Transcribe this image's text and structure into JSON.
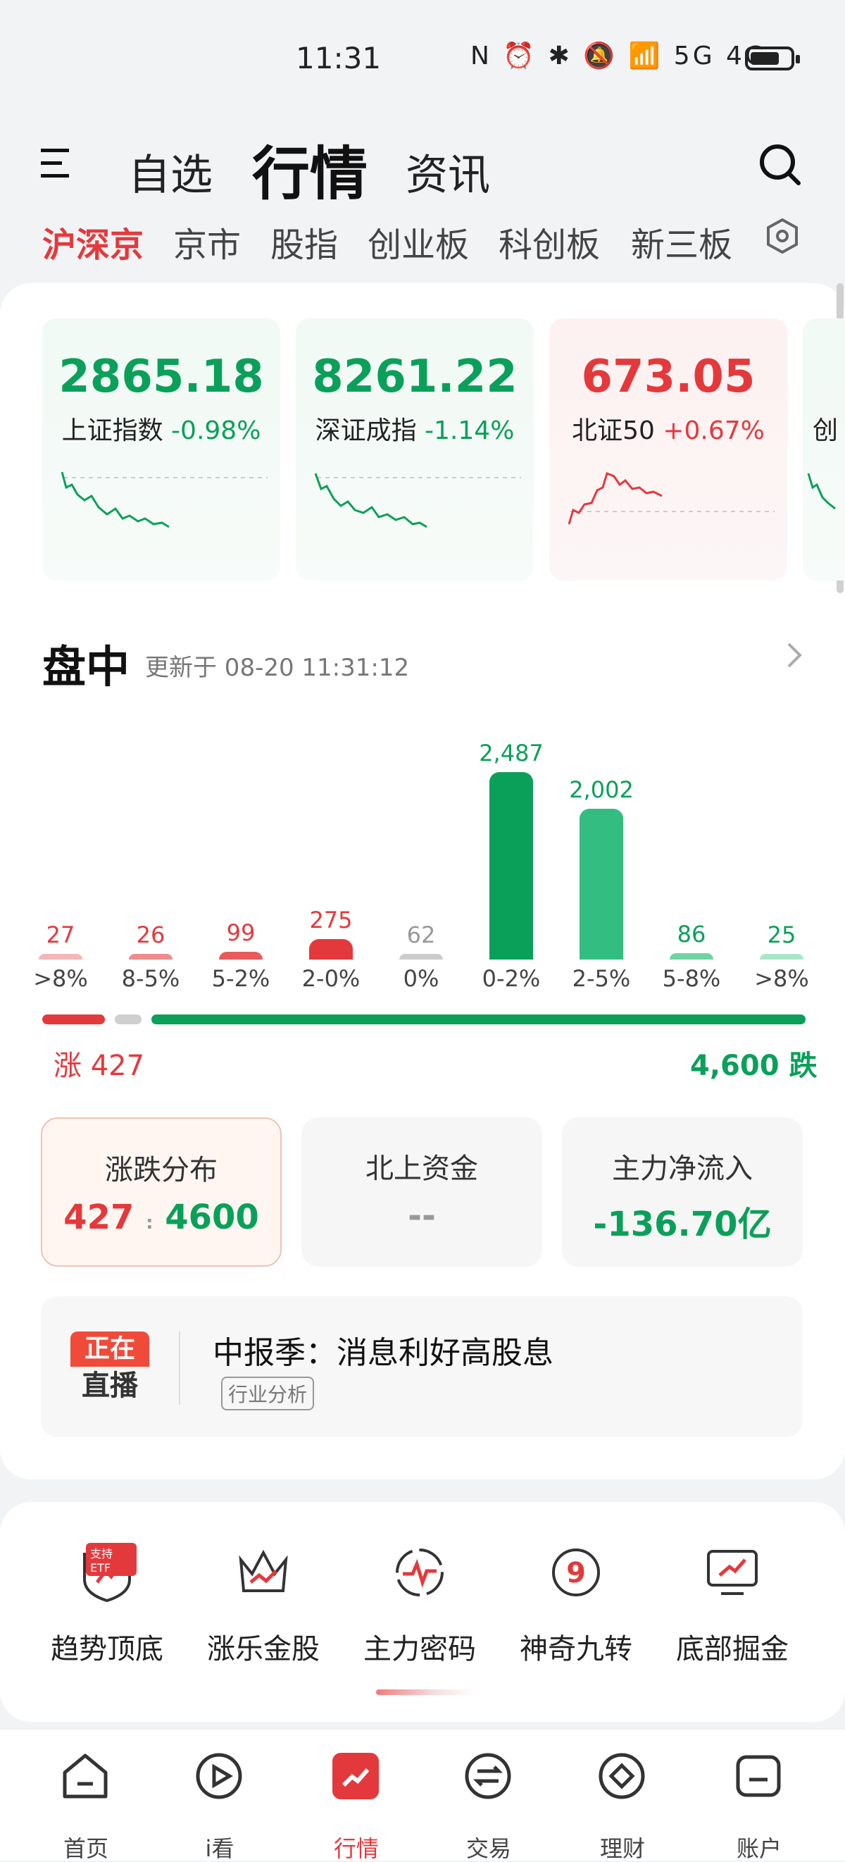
{
  "status": {
    "time": "11:31",
    "icons": "N ⏰ ✱ 🔕 📶 5G 4G",
    "battery": "battery-icon"
  },
  "header": {
    "tabs": [
      "自选",
      "行情",
      "资讯"
    ],
    "active_tab": "行情",
    "menu_icon": "menu-icon",
    "search_icon": "search-icon"
  },
  "subtabs": {
    "items": [
      "沪深京",
      "京市",
      "股指",
      "创业板",
      "科创板",
      "新三板"
    ],
    "active": "沪深京"
  },
  "indices": [
    {
      "value": "2865.18",
      "name": "上证指数",
      "change": "-0.98%",
      "color": "#0aa05a"
    },
    {
      "value": "8261.22",
      "name": "深证成指",
      "change": "-1.14%",
      "color": "#0aa05a"
    },
    {
      "value": "673.05",
      "name": "北证50",
      "change": "+0.67%",
      "color": "#e4393c"
    },
    {
      "value": "",
      "name": "创",
      "change": "",
      "color": "#0aa05a"
    }
  ],
  "market": {
    "title": "盘中",
    "updated": "更新于 08-20 11:31:12",
    "buckets": [
      {
        "label": ">8%",
        "count": "27",
        "n": 27,
        "color": "#f4b6b6",
        "text_color": "#e4393c"
      },
      {
        "label": "8-5%",
        "count": "26",
        "n": 26,
        "color": "#f08b8b",
        "text_color": "#e4393c"
      },
      {
        "label": "5-2%",
        "count": "99",
        "n": 99,
        "color": "#ea5a5a",
        "text_color": "#e4393c"
      },
      {
        "label": "2-0%",
        "count": "275",
        "n": 275,
        "color": "#e4393c",
        "text_color": "#e4393c"
      },
      {
        "label": "0%",
        "count": "62",
        "n": 62,
        "color": "#cccccc",
        "text_color": "#999999"
      },
      {
        "label": "0-2%",
        "count": "2,487",
        "n": 2487,
        "color": "#0aa05a",
        "text_color": "#0aa05a"
      },
      {
        "label": "2-5%",
        "count": "2,002",
        "n": 2002,
        "color": "#34bd81",
        "text_color": "#0aa05a"
      },
      {
        "label": "5-8%",
        "count": "86",
        "n": 86,
        "color": "#6fd4a4",
        "text_color": "#0aa05a"
      },
      {
        "label": ">8%",
        "count": "25",
        "n": 25,
        "color": "#a9e6c8",
        "text_color": "#0aa05a"
      }
    ],
    "up_label": "涨 427",
    "down_label": "4,600 跌",
    "up_total": 427,
    "flat_total": 62,
    "down_total": 4600
  },
  "stats": [
    {
      "title": "涨跌分布",
      "up": "427",
      "sep": ":",
      "down": "4600"
    },
    {
      "title": "北上资金",
      "value": "--"
    },
    {
      "title": "主力净流入",
      "value": "-136.70亿"
    }
  ],
  "live": {
    "badge_top": "正在",
    "badge_bottom": "直播",
    "title": "中报季：消息利好高股息",
    "tag": "行业分析"
  },
  "tools": [
    "趋势顶底",
    "涨乐金股",
    "主力密码",
    "神奇九转",
    "底部掘金"
  ],
  "tool_badge": "支持ETF",
  "nav": {
    "items": [
      "首页",
      "i看",
      "行情",
      "交易",
      "理财",
      "账户"
    ],
    "active": "行情"
  }
}
